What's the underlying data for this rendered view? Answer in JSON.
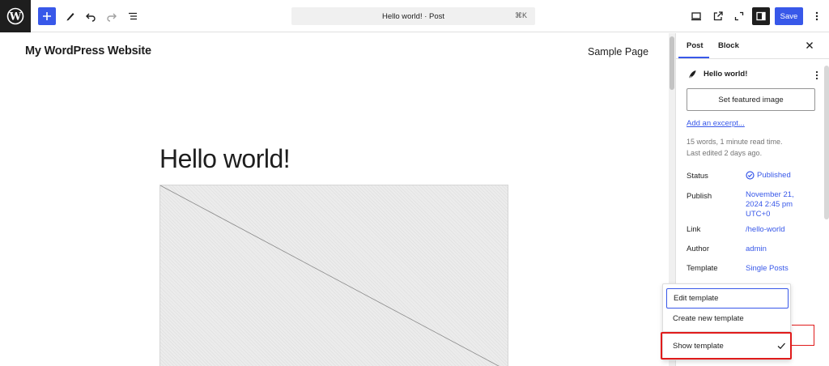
{
  "toolbar": {
    "command_bar_title": "Hello world! · Post",
    "command_shortcut": "⌘K",
    "save_label": "Save",
    "accent_color": "#3858e9"
  },
  "canvas": {
    "site_title": "My WordPress Website",
    "nav_link": "Sample Page",
    "post_title": "Hello world!"
  },
  "sidebar": {
    "tabs": {
      "post": "Post",
      "block": "Block"
    },
    "post_name": "Hello world!",
    "featured_image_button": "Set featured image",
    "excerpt_link": "Add an excerpt...",
    "word_count": "15 words, 1 minute read time.",
    "last_edited": "Last edited 2 days ago.",
    "rows": {
      "status_label": "Status",
      "status_value": "Published",
      "publish_label": "Publish",
      "publish_value_line1": "November 21,",
      "publish_value_line2": "2024 2:45 pm",
      "publish_value_line3": "UTC+0",
      "link_label": "Link",
      "link_value": "/hello-world",
      "author_label": "Author",
      "author_value": "admin",
      "template_label": "Template",
      "template_value": "Single Posts"
    }
  },
  "template_menu": {
    "edit": "Edit template",
    "create": "Create new template",
    "show": "Show template"
  }
}
